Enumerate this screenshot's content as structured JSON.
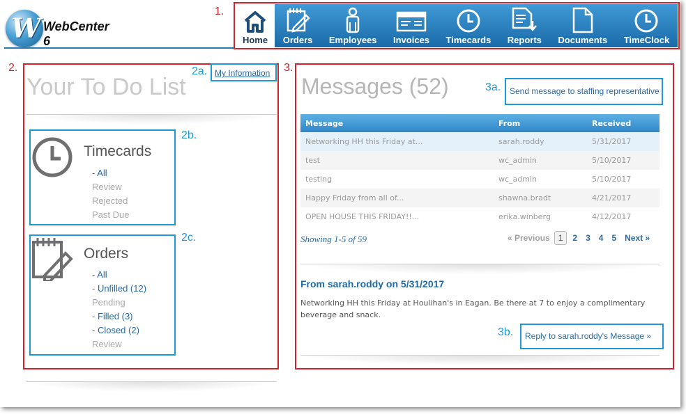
{
  "app": {
    "logo_text": "WebCenter 6",
    "logo_letter": "W"
  },
  "nav": [
    {
      "label": "Home",
      "icon": "home-icon"
    },
    {
      "label": "Orders",
      "icon": "notepad-pencil-icon"
    },
    {
      "label": "Employees",
      "icon": "person-icon"
    },
    {
      "label": "Invoices",
      "icon": "invoice-icon"
    },
    {
      "label": "Timecards",
      "icon": "clock-icon"
    },
    {
      "label": "Reports",
      "icon": "report-download-icon"
    },
    {
      "label": "Documents",
      "icon": "document-icon"
    },
    {
      "label": "TimeClock",
      "icon": "clock-icon"
    }
  ],
  "annotations": {
    "n1": "1.",
    "n2": "2.",
    "n3": "3.",
    "n2a": "2a.",
    "n2b": "2b.",
    "n2c": "2c.",
    "n3a": "3a.",
    "n3b": "3b."
  },
  "todo": {
    "title": "Your To Do List",
    "my_info": "My Information",
    "timecards": {
      "title": "Timecards",
      "items": [
        "- All",
        "Review",
        "Rejected",
        "Past Due"
      ]
    },
    "orders": {
      "title": "Orders",
      "items": [
        "- All",
        "- Unfilled (12)",
        "Pending",
        "- Filled (3)",
        "- Closed (2)",
        "Review"
      ]
    }
  },
  "messages": {
    "title": "Messages (52)",
    "send_link": "Send message to staffing representative",
    "columns": [
      "Message",
      "From",
      "Received"
    ],
    "rows": [
      [
        "Networking HH this Friday at...",
        "sarah.roddy",
        "5/31/2017"
      ],
      [
        "test",
        "wc_admin",
        "5/10/2017"
      ],
      [
        "testing",
        "wc_admin",
        "5/10/2017"
      ],
      [
        "Happy Friday from all of...",
        "shawna.bradt",
        "4/21/2017"
      ],
      [
        "OPEN HOUSE THIS FRIDAY!!...",
        "erika.winberg",
        "4/12/2017"
      ]
    ],
    "showing": "Showing 1-5 of 59",
    "pager": {
      "prev": "« Previous",
      "current": "1",
      "pages": [
        "2",
        "3",
        "4",
        "5"
      ],
      "next": "Next »"
    },
    "detail_title": "From sarah.roddy on 5/31/2017",
    "detail_body": "Networking HH this Friday at Houlihan's in Eagan. Be there at 7 to enjoy a complimentary beverage and snack.",
    "reply_link": "Reply to sarah.roddy's Message »"
  },
  "colors": {
    "annotation_red": "#d0232c",
    "annotation_blue": "#1d9ad6",
    "nav_blue": "#2a82c4",
    "link_blue": "#2a6aa3"
  }
}
